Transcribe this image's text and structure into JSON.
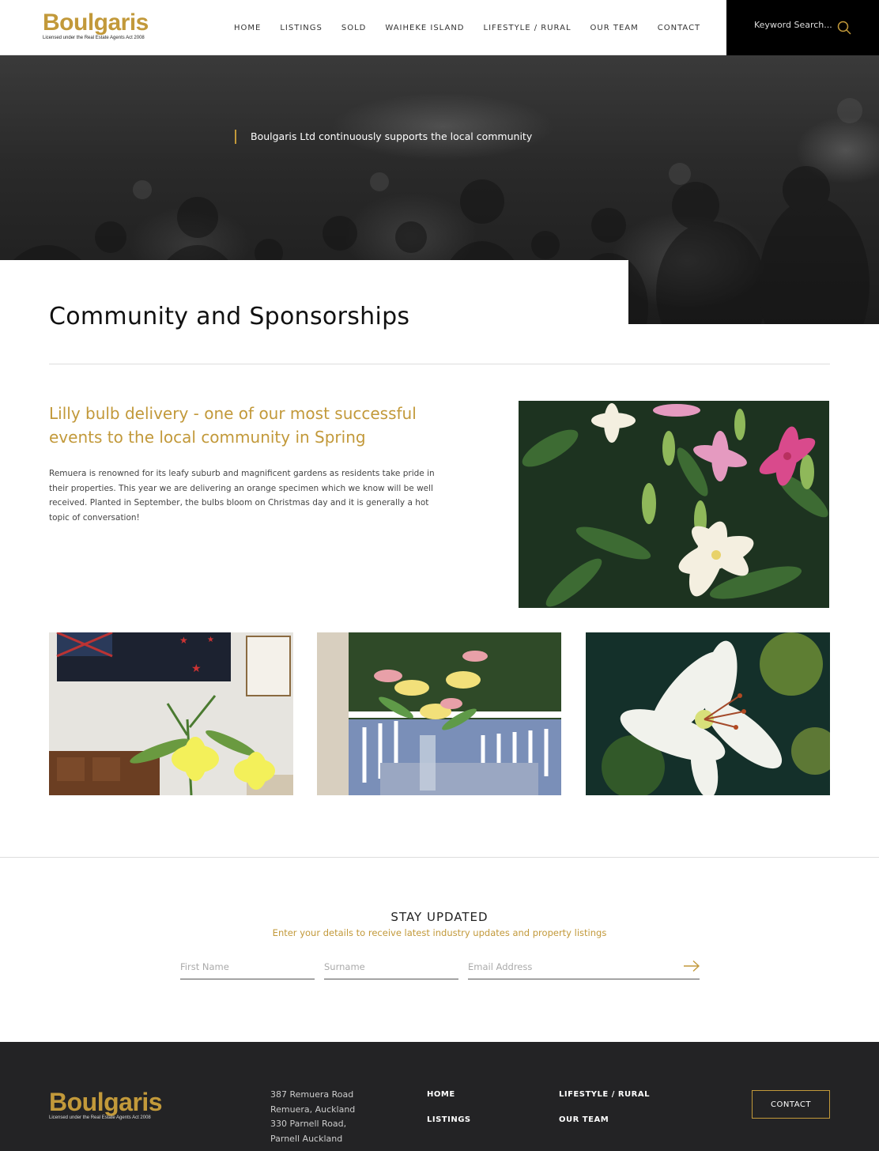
{
  "brand": {
    "name": "Boulgaris",
    "tagline": "Licensed under the Real Estate Agents Act 2008",
    "accent_color": "#c2993a"
  },
  "nav": {
    "items": [
      "HOME",
      "LISTINGS",
      "SOLD",
      "WAIHEKE ISLAND",
      "LIFESTYLE / RURAL",
      "OUR TEAM",
      "CONTACT"
    ]
  },
  "search": {
    "placeholder": "Keyword Search...",
    "icon": "search-icon"
  },
  "hero": {
    "quote": "Boulgaris Ltd continuously supports the local community"
  },
  "page": {
    "title": "Community and Sponsorships"
  },
  "feature": {
    "heading": "Lilly bulb delivery - one of our most successful events to the local community in Spring",
    "body": "Remuera is renowned for its leafy suburb and magnificent gardens as residents take pride in their properties. This year we are delivering an orange specimen which we know will be well received. Planted in September, the bulbs bloom on Christmas day and it is generally a hot topic of conversation!"
  },
  "newsletter": {
    "title": "STAY UPDATED",
    "subtitle": "Enter your details to receive latest industry updates and property listings",
    "first_name_placeholder": "First Name",
    "surname_placeholder": "Surname",
    "email_placeholder": "Email Address",
    "submit_icon": "arrow-right-icon"
  },
  "footer": {
    "address": [
      "387 Remuera Road",
      "Remuera, Auckland",
      "330 Parnell Road,",
      "Parnell Auckland"
    ],
    "nav_col1": [
      "HOME",
      "LISTINGS"
    ],
    "nav_col2": [
      "LIFESTYLE / RURAL",
      "OUR TEAM"
    ],
    "contact_button": "CONTACT"
  }
}
